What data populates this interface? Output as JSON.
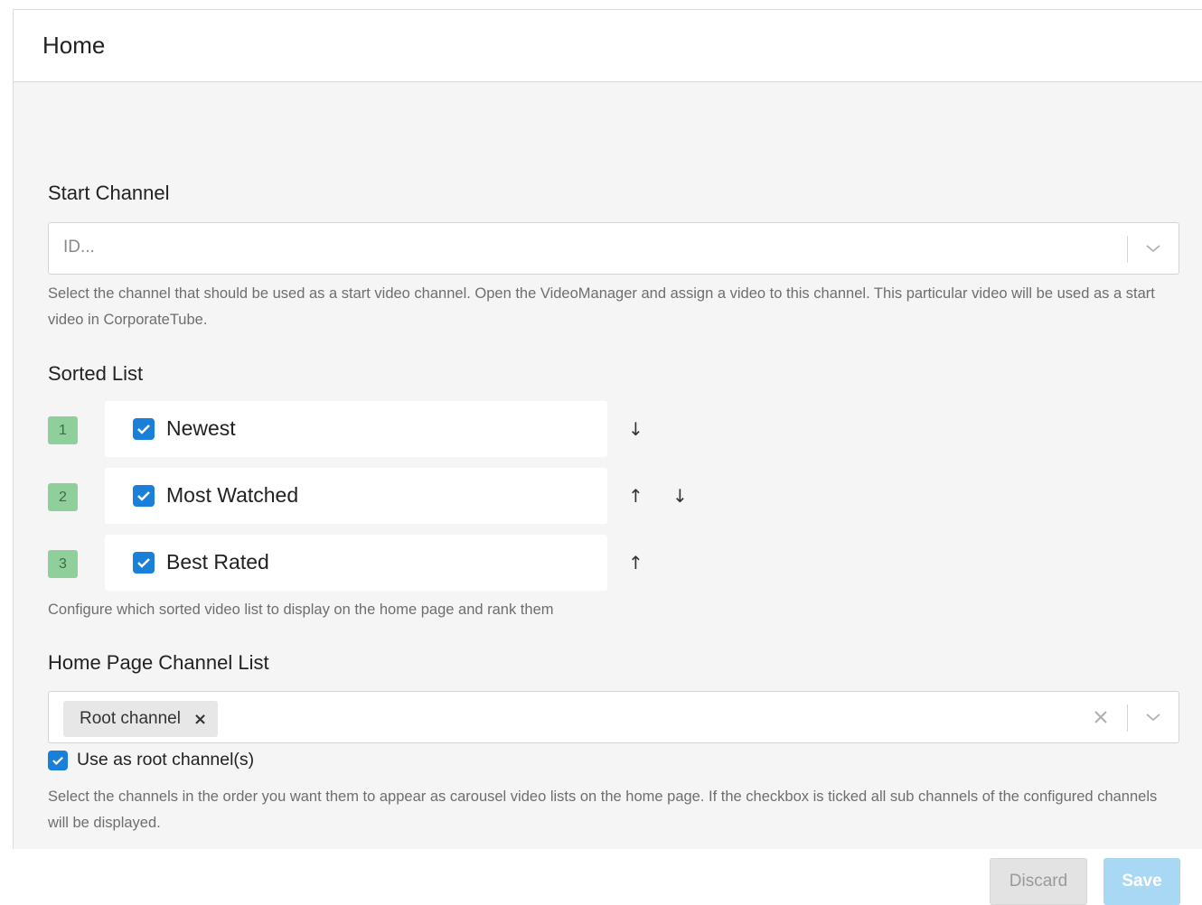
{
  "header": {
    "title": "Home"
  },
  "start_channel": {
    "label": "Start Channel",
    "placeholder": "ID...",
    "help": "Select the channel that should be used as a start video channel. Open the VideoManager and assign a video to this channel. This particular video will be used as a start video in CorporateTube."
  },
  "sorted_list": {
    "label": "Sorted List",
    "items": [
      {
        "rank": "1",
        "label": "Newest",
        "checked": true,
        "arrows": [
          "↓"
        ]
      },
      {
        "rank": "2",
        "label": "Most Watched",
        "checked": true,
        "arrows": [
          "↑",
          "↓"
        ]
      },
      {
        "rank": "3",
        "label": "Best Rated",
        "checked": true,
        "arrows": [
          "↑"
        ]
      }
    ],
    "help": "Configure which sorted video list to display on the home page and rank them"
  },
  "channel_list": {
    "label": "Home Page Channel List",
    "chips": [
      {
        "label": "Root channel",
        "remove": "×"
      }
    ],
    "clear": "×",
    "root_checkbox_label": "Use as root channel(s)",
    "root_checked": true,
    "help": "Select the channels in the order you want them to appear as carousel video lists on the home page. If the checkbox is ticked all sub channels of the configured channels will be displayed."
  },
  "actions": {
    "discard": "Discard",
    "save": "Save"
  },
  "colors": {
    "accent": "#1a7fd8",
    "rank_badge": "#8fcf9c",
    "save_disabled": "#a9d8f5"
  }
}
